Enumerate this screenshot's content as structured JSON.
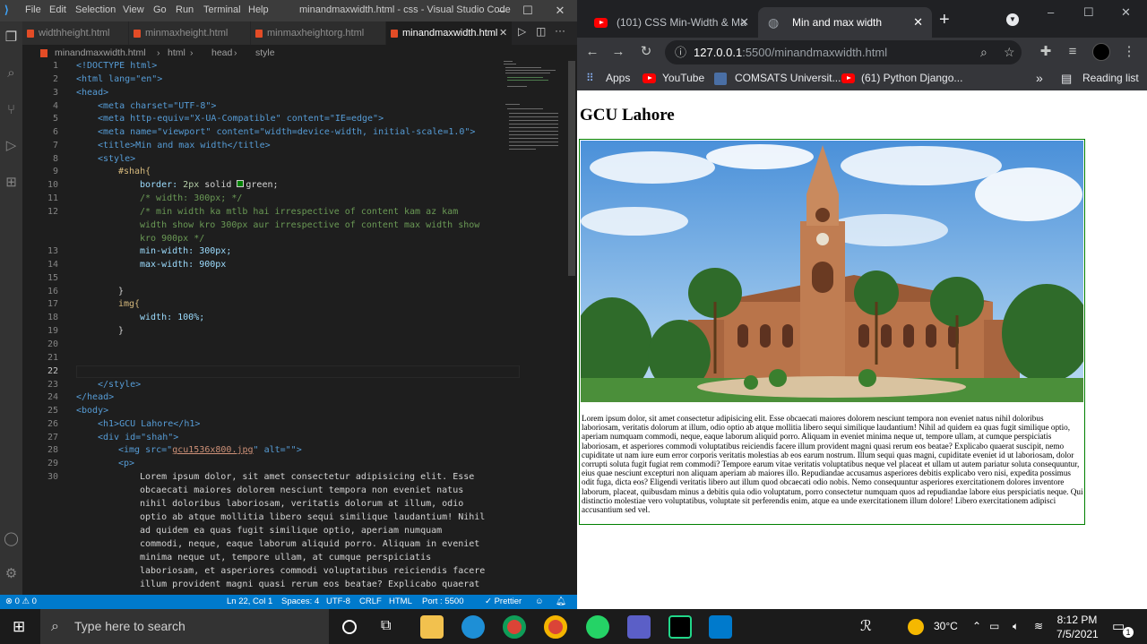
{
  "vscode": {
    "menu": [
      "File",
      "Edit",
      "Selection",
      "View",
      "Go",
      "Run",
      "Terminal",
      "Help"
    ],
    "title": "minandmaxwidth.html - css - Visual Studio Code",
    "tabs": [
      {
        "label": "widthheight.html"
      },
      {
        "label": "minmaxheight.html"
      },
      {
        "label": "minmaxheightorg.html"
      },
      {
        "label": "minandmaxwidth.html"
      }
    ],
    "breadcrumb": [
      "minandmaxwidth.html",
      "html",
      "head",
      "style"
    ],
    "line_numbers": [
      "1",
      "2",
      "3",
      "4",
      "5",
      "6",
      "7",
      "8",
      "9",
      "10",
      "11",
      "12",
      "",
      "",
      "13",
      "14",
      "15",
      "16",
      "17",
      "18",
      "19",
      "20",
      "21",
      "22",
      "23",
      "24",
      "25",
      "26",
      "27",
      "28",
      "29",
      "30"
    ],
    "code": {
      "l1": "<!DOCTYPE html>",
      "l2": "<html lang=\"en\">",
      "l3": "<head>",
      "l4": "<meta charset=\"UTF-8\">",
      "l5": "<meta http-equiv=\"X-UA-Compatible\" content=\"IE=edge\">",
      "l6": "<meta name=\"viewport\" content=\"width=device-width, initial-scale=1.0\">",
      "l7": "<title>Min and max width</title>",
      "l8": "<style>",
      "l9": "#shah{",
      "l10a": "border: ",
      "l10b": "2px",
      "l10c": " solid ",
      "l10d": "green;",
      "l11": "/* width: 300px; */",
      "l12a": "/* min width ka mtlb hai irrespective of content kam az kam",
      "l12b": "width show kro 300px aur irrespective of content max width show",
      "l12c": "kro 900px */",
      "l13": "min-width: 300px;",
      "l14": "max-width: 900px",
      "l16": "}",
      "l17": "img{",
      "l18": "width: 100%;",
      "l19": "}",
      "l23": "</style>",
      "l24": "</head>",
      "l25": "<body>",
      "l26": "<h1>GCU Lahore</h1>",
      "l27": "<div id=\"shah\">",
      "l28a": "<img src=\"",
      "l28b": "gcu1536x800.jpg",
      "l28c": "\" alt=\"\">",
      "l29": "<p>",
      "l30": [
        "Lorem ipsum dolor, sit amet consectetur adipisicing elit. Esse",
        "obcaecati maiores dolorem nesciunt tempora non eveniet natus",
        "nihil doloribus laboriosam, veritatis dolorum at illum, odio",
        "optio ab atque mollitia libero sequi similique laudantium! Nihil",
        "ad quidem ea quas fugit similique optio, aperiam numquam",
        "commodi, neque, eaque laborum aliquid porro. Aliquam in eveniet",
        "minima neque ut, tempore ullam, at cumque perspiciatis",
        "laboriosam, et asperiores commodi voluptatibus reiciendis facere",
        "illum provident magni quasi rerum eos beatae? Explicabo quaerat"
      ]
    },
    "status": {
      "problems": "⊗ 0 ⚠ 0",
      "position": "Ln 22, Col 1",
      "spaces": "Spaces: 4",
      "encoding": "UTF-8",
      "eol": "CRLF",
      "language": "HTML",
      "port": "Port : 5500",
      "prettier": "✓ Prettier"
    }
  },
  "chrome": {
    "tabs": [
      {
        "title": "(101) CSS Min-Width & Ma"
      },
      {
        "title": "Min and max width"
      }
    ],
    "url_host": "127.0.0.1",
    "url_path": ":5500/minandmaxwidth.html",
    "bookmarks": [
      "Apps",
      "YouTube",
      "COMSATS Universit...",
      "(61) Python Django..."
    ],
    "reading_list": "Reading list",
    "page": {
      "heading": "GCU Lahore",
      "paragraph": "Lorem ipsum dolor, sit amet consectetur adipisicing elit. Esse obcaecati maiores dolorem nesciunt tempora non eveniet natus nihil doloribus laboriosam, veritatis dolorum at illum, odio optio ab atque mollitia libero sequi similique laudantium! Nihil ad quidem ea quas fugit similique optio, aperiam numquam commodi, neque, eaque laborum aliquid porro. Aliquam in eveniet minima neque ut, tempore ullam, at cumque perspiciatis laboriosam, et asperiores commodi voluptatibus reiciendis facere illum provident magni quasi rerum eos beatae? Explicabo quaerat suscipit, nemo cupiditate ut nam iure eum error corporis veritatis molestias ab eos earum nostrum. Illum sequi quas magni, cupiditate eveniet id ut laboriosam, dolor corrupti soluta fugit fugiat rem commodi? Tempore earum vitae veritatis voluptatibus neque vel placeat et ullam ut autem pariatur soluta consequuntur, eius quae nesciunt excepturi non aliquam aperiam ab maiores illo. Repudiandae accusamus asperiores debitis explicabo vero nisi, expedita possimus odit fuga, dicta eos? Eligendi veritatis libero aut illum quod obcaecati odio nobis. Nemo consequuntur asperiores exercitationem dolores inventore laborum, placeat, quibusdam minus a debitis quia odio voluptatum, porro consectetur numquam quos ad repudiandae labore eius perspiciatis neque. Qui distinctio molestiae vero voluptatibus, voluptate sit perferendis enim, atque ea unde exercitationem illum dolore! Libero exercitationem adipisci accusantium sed vel."
    }
  },
  "taskbar": {
    "search_placeholder": "Type here to search",
    "temperature": "30°C",
    "time": "8:12 PM",
    "date": "7/5/2021",
    "notification_count": "1"
  },
  "colors": {
    "vscode_blue": "#007acc",
    "chrome_dark": "#202124",
    "border_green": "#008000"
  }
}
